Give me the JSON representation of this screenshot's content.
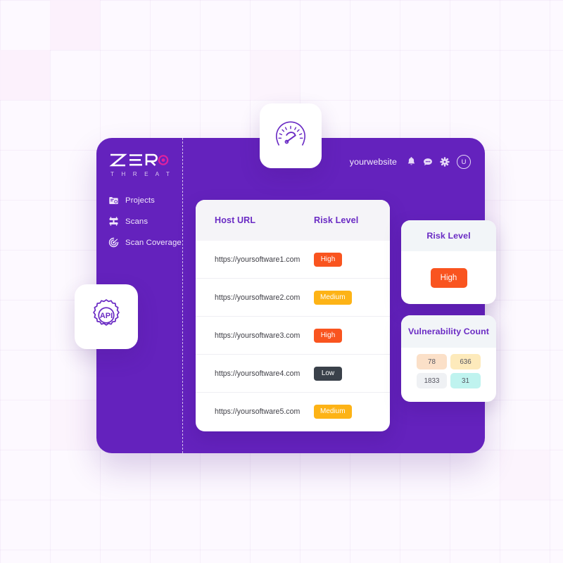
{
  "brand": {
    "logo_word": "ZERO",
    "logo_sub": "T H R E A T",
    "accent": "#6422bd",
    "logo_dot_color": "#e0219f"
  },
  "sidebar": {
    "items": [
      {
        "label": "Projects",
        "icon": "folder-icon"
      },
      {
        "label": "Scans",
        "icon": "scan-icon"
      },
      {
        "label": "Scan Coverage",
        "icon": "radar-icon"
      }
    ]
  },
  "topbar": {
    "site_name": "yourwebsite",
    "icons": [
      {
        "name": "bell-icon"
      },
      {
        "name": "chat-icon"
      },
      {
        "name": "gear-icon"
      }
    ],
    "avatar_initial": "U"
  },
  "table": {
    "columns": [
      "Host URL",
      "Risk Level"
    ],
    "rows": [
      {
        "url": "https://yoursoftware1.com",
        "risk": "High",
        "risk_class": "high"
      },
      {
        "url": "https://yoursoftware2.com",
        "risk": "Medium",
        "risk_class": "medium"
      },
      {
        "url": "https://yoursoftware3.com",
        "risk": "High",
        "risk_class": "high"
      },
      {
        "url": "https://yoursoftware4.com",
        "risk": "Low",
        "risk_class": "low"
      },
      {
        "url": "https://yoursoftware5.com",
        "risk": "Medium",
        "risk_class": "medium"
      }
    ]
  },
  "risk_card": {
    "title": "Risk Level",
    "value": "High",
    "value_class": "high"
  },
  "vulnerability_card": {
    "title": "Vulnerability Count",
    "counts": [
      {
        "value": "78",
        "color": "#fbe0c8"
      },
      {
        "value": "636",
        "color": "#fdeabb"
      },
      {
        "value": "1833",
        "color": "#eff1f4"
      },
      {
        "value": "31",
        "color": "#bff3ef"
      }
    ]
  },
  "floating_tiles": [
    {
      "name": "gauge-icon"
    },
    {
      "name": "api-gear-icon"
    }
  ],
  "badge_colors": {
    "high": "#f9541f",
    "medium": "#fdb316",
    "low": "#3a414a"
  }
}
